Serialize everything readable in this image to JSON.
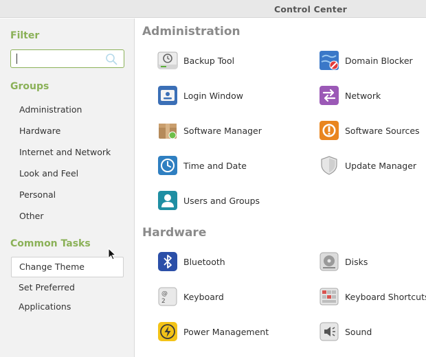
{
  "window": {
    "title": "Control Center"
  },
  "sidebar": {
    "filter_heading": "Filter",
    "search": {
      "value": "",
      "placeholder": ""
    },
    "groups_heading": "Groups",
    "groups": [
      "Administration",
      "Hardware",
      "Internet and Network",
      "Look and Feel",
      "Personal",
      "Other"
    ],
    "tasks_heading": "Common Tasks",
    "tasks": [
      "Change Theme",
      "Set Preferred Applications"
    ]
  },
  "sections": [
    {
      "title": "Administration",
      "items": [
        {
          "label": "Backup Tool",
          "icon": "backup-tool-icon"
        },
        {
          "label": "Domain Blocker",
          "icon": "domain-blocker-icon"
        },
        {
          "label": "Login Window",
          "icon": "login-window-icon"
        },
        {
          "label": "Network",
          "icon": "network-icon"
        },
        {
          "label": "Software Manager",
          "icon": "software-manager-icon"
        },
        {
          "label": "Software Sources",
          "icon": "software-sources-icon"
        },
        {
          "label": "Time and Date",
          "icon": "clock-icon"
        },
        {
          "label": "Update Manager",
          "icon": "shield-icon"
        },
        {
          "label": "Users and Groups",
          "icon": "user-icon"
        }
      ]
    },
    {
      "title": "Hardware",
      "items": [
        {
          "label": "Bluetooth",
          "icon": "bluetooth-icon"
        },
        {
          "label": "Disks",
          "icon": "disk-icon"
        },
        {
          "label": "Keyboard",
          "icon": "keyboard-icon"
        },
        {
          "label": "Keyboard Shortcuts",
          "icon": "keyboard-shortcuts-icon"
        },
        {
          "label": "Power Management",
          "icon": "power-icon"
        },
        {
          "label": "Sound",
          "icon": "speaker-icon"
        }
      ]
    }
  ]
}
